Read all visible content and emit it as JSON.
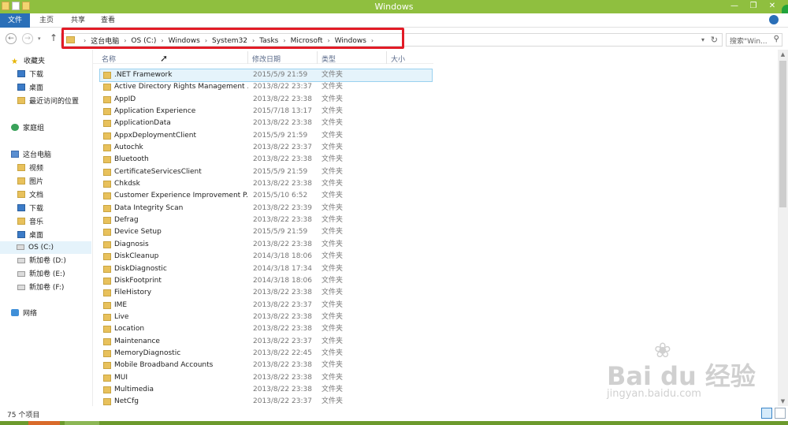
{
  "window": {
    "title": "Windows"
  },
  "ribbon": {
    "tabs": [
      "文件",
      "主页",
      "共享",
      "查看"
    ]
  },
  "address": {
    "crumbs": [
      "这台电脑",
      "OS (C:)",
      "Windows",
      "System32",
      "Tasks",
      "Microsoft",
      "Windows"
    ],
    "search_placeholder": "搜索\"Win..."
  },
  "sidebar": {
    "favorites": {
      "label": "收藏夹",
      "items": [
        "下载",
        "桌面",
        "最近访问的位置"
      ]
    },
    "homegroup": {
      "label": "家庭组"
    },
    "thispc": {
      "label": "这台电脑",
      "items": [
        "视频",
        "图片",
        "文档",
        "下载",
        "音乐",
        "桌面",
        "OS (C:)",
        "新加卷 (D:)",
        "新加卷 (E:)",
        "新加卷 (F:)"
      ]
    },
    "network": {
      "label": "网络"
    }
  },
  "columns": {
    "name": "名称",
    "date": "修改日期",
    "type": "类型",
    "size": "大小"
  },
  "files": [
    {
      "name": ".NET Framework",
      "date": "2015/5/9 21:59",
      "type": "文件夹"
    },
    {
      "name": "Active Directory Rights Management ...",
      "date": "2013/8/22 23:37",
      "type": "文件夹"
    },
    {
      "name": "AppID",
      "date": "2013/8/22 23:38",
      "type": "文件夹"
    },
    {
      "name": "Application Experience",
      "date": "2015/7/18 13:17",
      "type": "文件夹"
    },
    {
      "name": "ApplicationData",
      "date": "2013/8/22 23:38",
      "type": "文件夹"
    },
    {
      "name": "AppxDeploymentClient",
      "date": "2015/5/9 21:59",
      "type": "文件夹"
    },
    {
      "name": "Autochk",
      "date": "2013/8/22 23:37",
      "type": "文件夹"
    },
    {
      "name": "Bluetooth",
      "date": "2013/8/22 23:38",
      "type": "文件夹"
    },
    {
      "name": "CertificateServicesClient",
      "date": "2015/5/9 21:59",
      "type": "文件夹"
    },
    {
      "name": "Chkdsk",
      "date": "2013/8/22 23:38",
      "type": "文件夹"
    },
    {
      "name": "Customer Experience Improvement P...",
      "date": "2015/5/10 6:52",
      "type": "文件夹"
    },
    {
      "name": "Data Integrity Scan",
      "date": "2013/8/22 23:39",
      "type": "文件夹"
    },
    {
      "name": "Defrag",
      "date": "2013/8/22 23:38",
      "type": "文件夹"
    },
    {
      "name": "Device Setup",
      "date": "2015/5/9 21:59",
      "type": "文件夹"
    },
    {
      "name": "Diagnosis",
      "date": "2013/8/22 23:38",
      "type": "文件夹"
    },
    {
      "name": "DiskCleanup",
      "date": "2014/3/18 18:06",
      "type": "文件夹"
    },
    {
      "name": "DiskDiagnostic",
      "date": "2014/3/18 17:34",
      "type": "文件夹"
    },
    {
      "name": "DiskFootprint",
      "date": "2014/3/18 18:06",
      "type": "文件夹"
    },
    {
      "name": "FileHistory",
      "date": "2013/8/22 23:38",
      "type": "文件夹"
    },
    {
      "name": "IME",
      "date": "2013/8/22 23:37",
      "type": "文件夹"
    },
    {
      "name": "Live",
      "date": "2013/8/22 23:38",
      "type": "文件夹"
    },
    {
      "name": "Location",
      "date": "2013/8/22 23:38",
      "type": "文件夹"
    },
    {
      "name": "Maintenance",
      "date": "2013/8/22 23:37",
      "type": "文件夹"
    },
    {
      "name": "MemoryDiagnostic",
      "date": "2013/8/22 22:45",
      "type": "文件夹"
    },
    {
      "name": "Mobile Broadband Accounts",
      "date": "2013/8/22 23:38",
      "type": "文件夹"
    },
    {
      "name": "MUI",
      "date": "2013/8/22 23:38",
      "type": "文件夹"
    },
    {
      "name": "Multimedia",
      "date": "2013/8/22 23:38",
      "type": "文件夹"
    },
    {
      "name": "NetCfg",
      "date": "2013/8/22 23:37",
      "type": "文件夹"
    }
  ],
  "status": {
    "count": "75 个项目"
  },
  "watermark": {
    "brand": "Bai du 经验",
    "sub": "jingyan.baidu.com"
  },
  "colors": {
    "titlebar": "#8fbf3f",
    "file_tab": "#2a6fb8",
    "highlight": "#e21b26",
    "selected_row": "#e5f3fb"
  }
}
